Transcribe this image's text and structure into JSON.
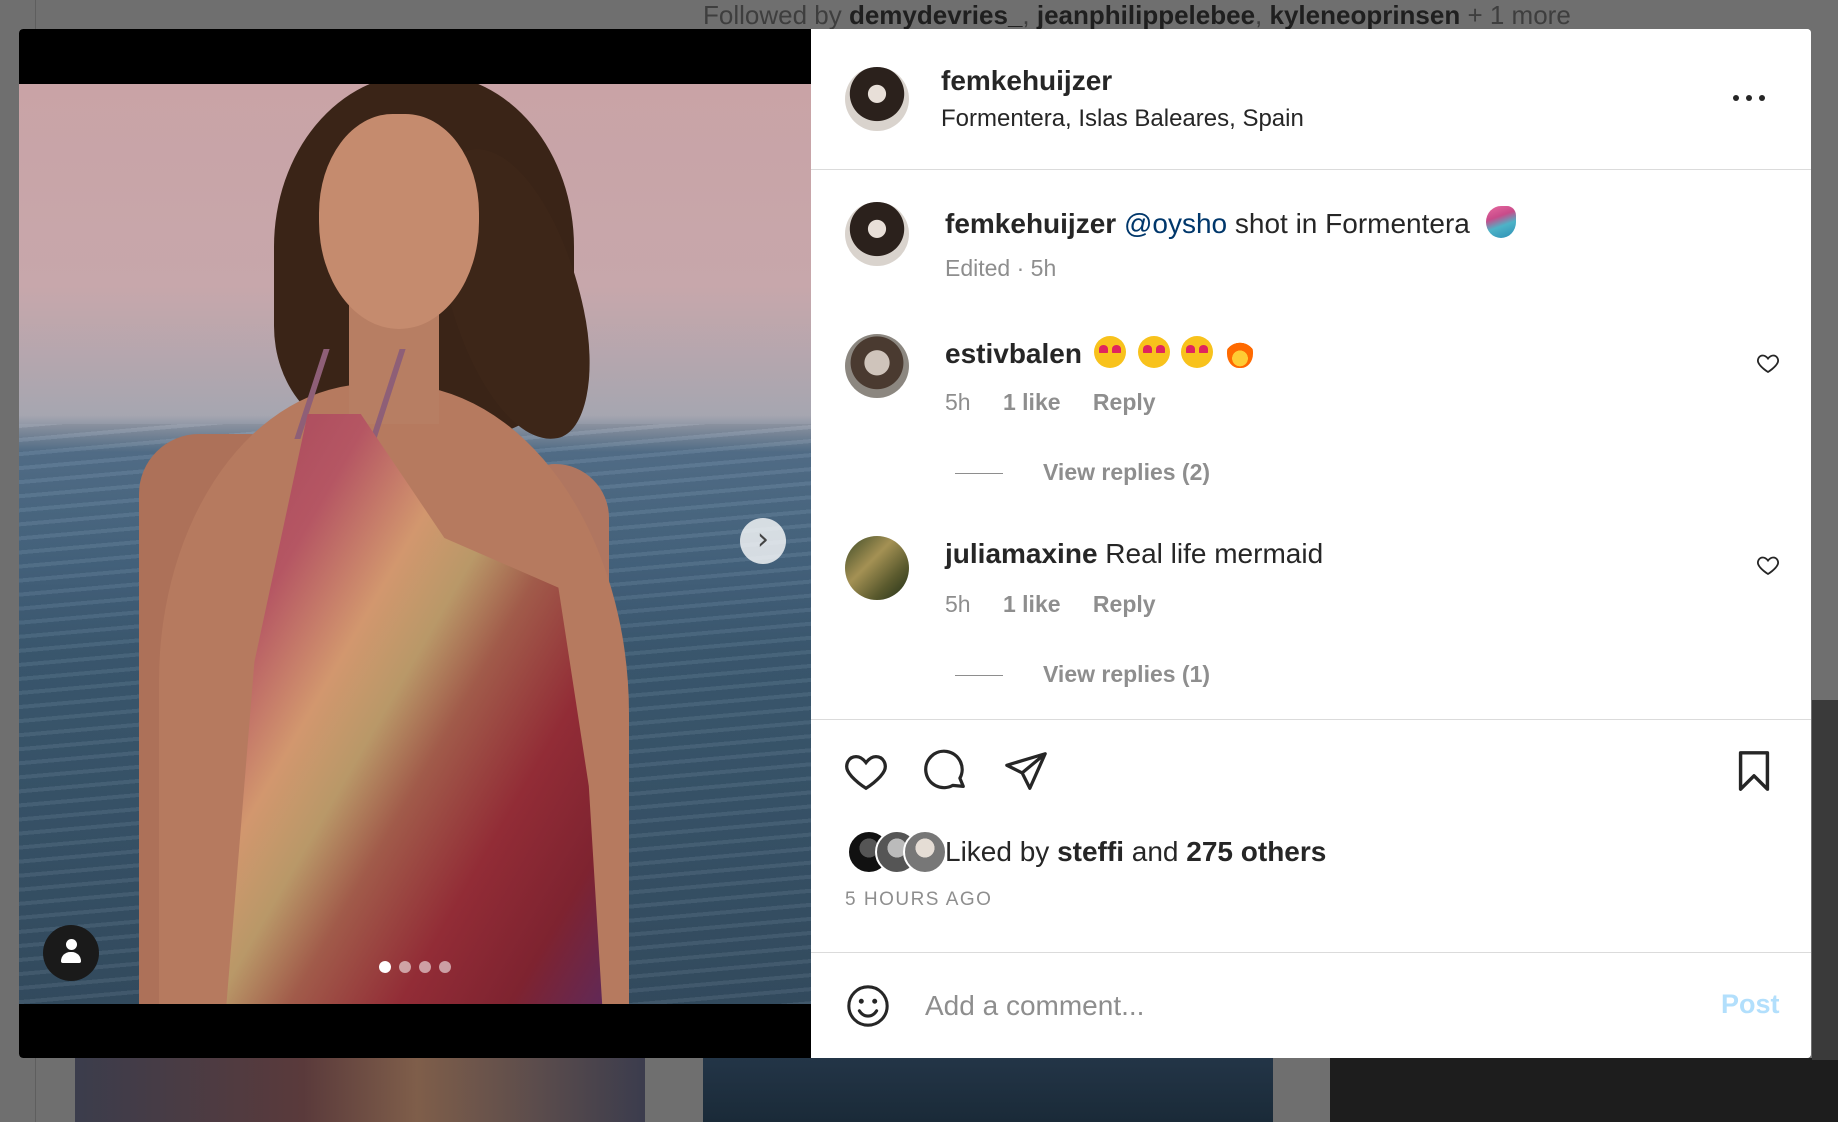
{
  "background": {
    "followed_prefix": "Followed by",
    "followed_users": [
      "demydevries_",
      "jeanphilippelebee",
      "kyleneoprinsen"
    ],
    "followed_more": "+ 1 more"
  },
  "media": {
    "next_icon": "chevron-right-icon",
    "next_glyph": "›",
    "user_tag_icon": "person-icon",
    "carousel_count": 4,
    "carousel_active": 0
  },
  "post": {
    "username": "femkehuijzer",
    "location": "Formentera, Islas Baleares, Spain",
    "caption": {
      "username": "femkehuijzer",
      "mention": "@oysho",
      "text": "shot in Formentera",
      "emoji": "mermaid-emoji",
      "meta": "Edited · 5h"
    }
  },
  "comments": [
    {
      "username": "estivbalen",
      "emojis": [
        "heart-eyes-emoji",
        "heart-eyes-emoji",
        "heart-eyes-emoji",
        "fire-emoji"
      ],
      "time": "5h",
      "likes": "1 like",
      "reply": "Reply",
      "view_replies": "View replies (2)"
    },
    {
      "username": "juliamaxine",
      "text": "Real life mermaid",
      "time": "5h",
      "likes": "1 like",
      "reply": "Reply",
      "view_replies": "View replies (1)"
    }
  ],
  "actions": {
    "icons": [
      "heart-icon",
      "comment-icon",
      "share-icon",
      "bookmark-icon"
    ],
    "liked_by_prefix": "Liked by",
    "liked_by_user": "steffi",
    "liked_by_and": "and",
    "liked_by_others": "275 others",
    "time_ago": "5 HOURS AGO"
  },
  "composer": {
    "placeholder": "Add a comment...",
    "post_label": "Post"
  },
  "colors": {
    "text": "#262626",
    "muted": "#8e8e8e",
    "mention": "#00376b",
    "post_disabled": "#b2dffc",
    "border": "#dbdbdb"
  }
}
